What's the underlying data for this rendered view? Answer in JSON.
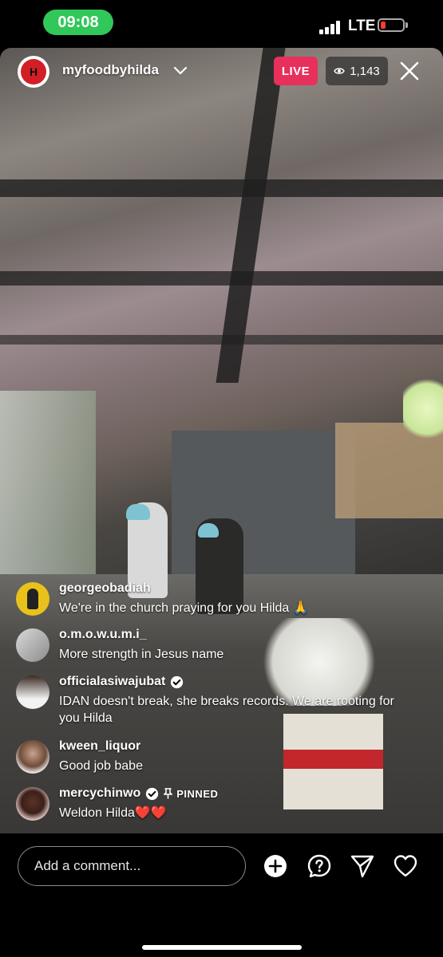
{
  "status_bar": {
    "time": "09:08",
    "network": "LTE"
  },
  "header": {
    "host_name": "myfoodbyhilda",
    "live_label": "LIVE",
    "viewer_count": "1,143"
  },
  "comments": [
    {
      "username": "georgeobadiah",
      "text": "We're in the church praying for you Hilda 🙏",
      "verified": false,
      "pinned": false
    },
    {
      "username": "o.m.o.w.u.m.i_",
      "text": "More strength in Jesus name",
      "verified": false,
      "pinned": false
    },
    {
      "username": "officialasiwajubat",
      "text": "IDAN doesn't break, she breaks records. We are rooting for you Hilda",
      "verified": true,
      "pinned": false
    },
    {
      "username": "kween_liquor",
      "text": "Good job babe",
      "verified": false,
      "pinned": false
    },
    {
      "username": "mercychinwo",
      "text": "Weldon Hilda",
      "hearts": "❤️❤️",
      "verified": true,
      "pinned": true,
      "pinned_label": "PINNED"
    }
  ],
  "bottom_bar": {
    "comment_placeholder": "Add a comment..."
  },
  "colors": {
    "live": "#e8305c",
    "time_pill": "#31c759",
    "verified": "#3897f0"
  }
}
